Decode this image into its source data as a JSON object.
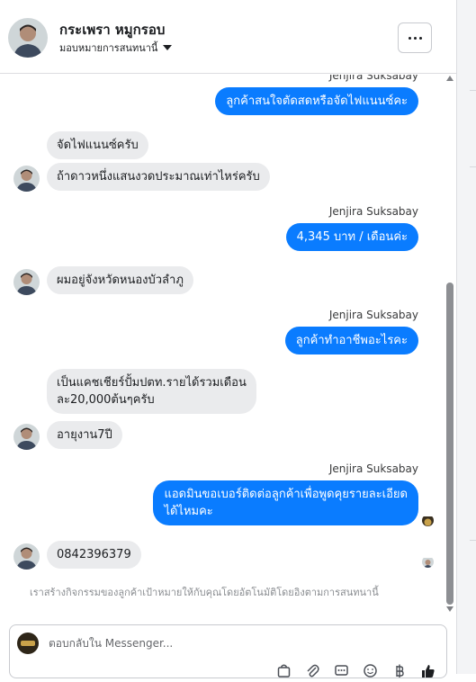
{
  "header": {
    "name": "กระเพรา หมูกรอบ",
    "assign_label": "มอบหมายการสนทนานี้",
    "more_icon": "more-horizontal-icon"
  },
  "messages": [
    {
      "id": "m1",
      "direction": "out",
      "sender": "Jenjira Suksabay",
      "text": "ลูกค้าสนใจตัดสดหรือจัดไฟแนนซ์คะ"
    },
    {
      "id": "m2",
      "direction": "in",
      "text": "จัดไฟแนนซ์ครับ"
    },
    {
      "id": "m3",
      "direction": "in",
      "text": "ถ้าดาวหนึ่งแสนงวดประมาณเท่าไหร่ครับ"
    },
    {
      "id": "m4",
      "direction": "out",
      "sender": "Jenjira Suksabay",
      "text": "4,345 บาท / เดือนค่ะ"
    },
    {
      "id": "m5",
      "direction": "in",
      "text": "ผมอยู่จังหวัดหนองบัวลำภู"
    },
    {
      "id": "m6",
      "direction": "out",
      "sender": "Jenjira Suksabay",
      "text": "ลูกค้าทำอาชีพอะไรคะ"
    },
    {
      "id": "m7",
      "direction": "in",
      "line1": "เป็นแคชเชียร์ปั้มปตท.รายได้รวมเดือน",
      "line2": "ละ20,000ต้นๆครับ"
    },
    {
      "id": "m8",
      "direction": "in",
      "text": "อายุงาน7ปี"
    },
    {
      "id": "m9",
      "direction": "out",
      "sender": "Jenjira Suksabay",
      "line1": "แอดมินขอเบอร์ติดต่อลูกค้าเพื่อพูดคุยรายละเอียด",
      "line2": "ได้ไหมคะ"
    },
    {
      "id": "m10",
      "direction": "in",
      "text": "0842396379"
    }
  ],
  "notice": "เราสร้างกิจกรรมของลูกค้าเป้าหมายให้กับคุณโดยอัตโนมัติโดยอิงตามการสนทนานี้",
  "composer": {
    "placeholder": "ตอบกลับใน Messenger...",
    "tool_icons": [
      "bag-icon",
      "paperclip-icon",
      "chat-bubble-icon",
      "emoji-icon",
      "baht-icon",
      "thumbs-up-icon"
    ]
  },
  "colors": {
    "outgoing_bubble": "#0a7cff",
    "incoming_bubble": "#eaebed",
    "text": "#1c1e21"
  }
}
